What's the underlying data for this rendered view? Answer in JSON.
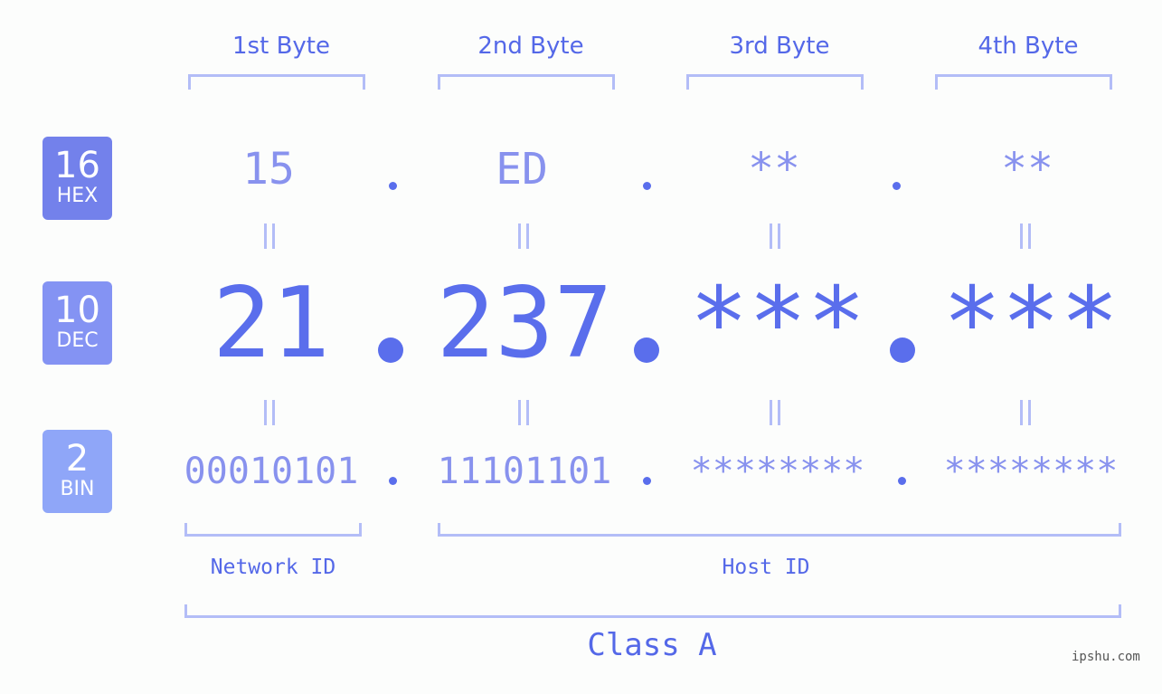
{
  "bytes": {
    "headers": [
      "1st Byte",
      "2nd Byte",
      "3rd Byte",
      "4th Byte"
    ]
  },
  "bases": {
    "hex": {
      "number": "16",
      "label": "HEX",
      "color": "#7381eb"
    },
    "dec": {
      "number": "10",
      "label": "DEC",
      "color": "#8493f3"
    },
    "bin": {
      "number": "2",
      "label": "BIN",
      "color": "#8fa6f8"
    }
  },
  "values": {
    "hex": [
      "15",
      "ED",
      "**",
      "**"
    ],
    "dec": [
      "21",
      "237",
      "***",
      "***"
    ],
    "bin": [
      "00010101",
      "11101101",
      "********",
      "********"
    ]
  },
  "groups": {
    "network_id": "Network ID",
    "host_id": "Host ID",
    "class": "Class A"
  },
  "watermark": "ipshu.com",
  "colors": {
    "accent": "#5a6eec",
    "light": "#8892ee",
    "bracket": "#b3bdf7",
    "background": "#fcfdfc"
  }
}
